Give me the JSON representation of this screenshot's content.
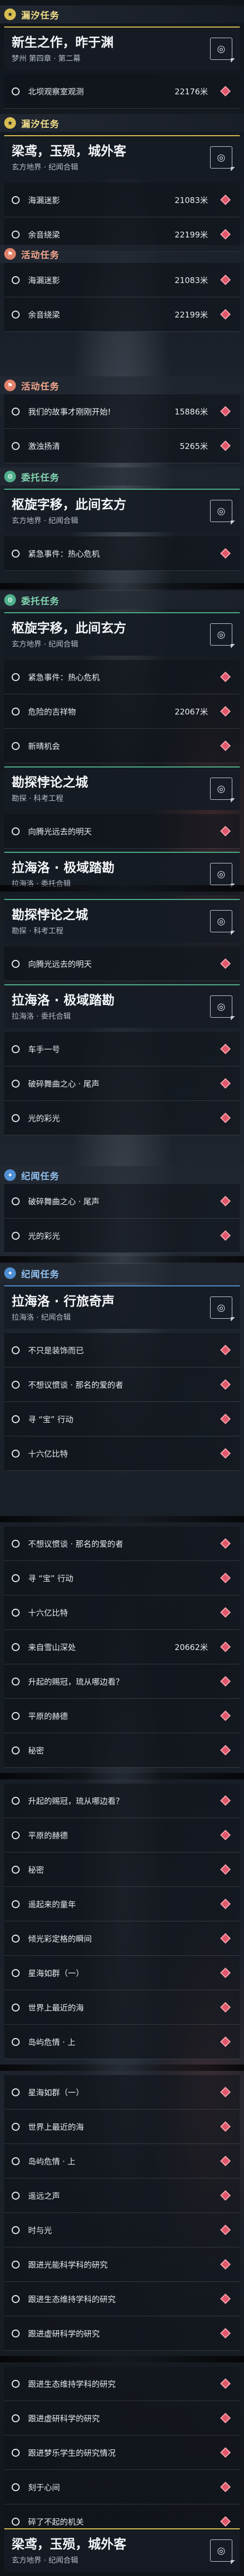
{
  "status_colors": {
    "story": "#d9bf52",
    "activity": "#e1826a",
    "daily": "#4fb08c",
    "legend": "#4f8fd3",
    "pin": "#e0566a"
  },
  "icons": {
    "story": "star-icon",
    "activity": "flag-icon",
    "daily": "gear-icon",
    "legend": "sparkle-icon",
    "checkbox": "objective-circle-icon",
    "pin": "map-pin-icon",
    "track": "track-quest-icon"
  },
  "categories": {
    "story": "漏汐任务",
    "story2": "漏汐任务",
    "activity": "活动任务",
    "daily": "委托任务",
    "legend": "纪闻任务"
  },
  "quests": {
    "q_story_intro": {
      "title": "新生之作，昨于渊",
      "sub": "梦州 第四章 · 第二幕"
    },
    "q_story_main": {
      "title": "梁鸢，玉殒，城外客",
      "sub": "玄方地界 · 纪闻合辑"
    },
    "q_daily_a": {
      "title": "枢旋字移，此间玄方",
      "sub": "玄方地界 · 纪闻合辑"
    },
    "q_daily_b": {
      "title": "勘探悖论之城",
      "sub": "勘探 · 科考工程"
    },
    "q_daily_c": {
      "title": "拉海洛 · 极域踏勘",
      "sub": "拉海洛 · 委托合辑"
    },
    "q_legend_a": {
      "title": "拉海洛 · 行旅奇声",
      "sub": "拉海洛 · 纪闻合辑"
    },
    "q_end": {
      "title": "梁鸢，玉殒，城外客",
      "sub": "玄方地界 · 纪闻合辑"
    }
  },
  "objectives": {
    "o1": {
      "text": "北坝观察室观测",
      "count": "22176米"
    },
    "o2": {
      "text": "海漏迷影",
      "count": "21083米"
    },
    "o3": {
      "text": "余音绕梁",
      "count": "22199米"
    },
    "o4": {
      "text": "我们的故事才刚刚开始!",
      "count": "15886米"
    },
    "o5": {
      "text": "激浊扬清",
      "count": "5265米"
    },
    "o6": {
      "text": "紧急事件：热心危机"
    },
    "o7": {
      "text": "危险的吉祥物",
      "count": "22067米"
    },
    "o8": {
      "text": "新晴机会"
    },
    "o9": {
      "text": "向腾光远去的明天"
    },
    "o10": {
      "text": "车手一号"
    },
    "o11": {
      "text": "破碎舞曲之心 · 尾声"
    },
    "o12": {
      "text": "光的彩光"
    },
    "o13": {
      "text": "不只是装饰而已"
    },
    "o14": {
      "text": "不想议惯谈 · 那名的爱的者"
    },
    "o15": {
      "text": "寻 “宝” 行动"
    },
    "o16": {
      "text": "十六亿比特"
    },
    "o17": {
      "text": "来自雪山深处",
      "count": "20662米"
    },
    "o18": {
      "text": "升起的赐冠，琉从哪边看？"
    },
    "o19": {
      "text": "平原的赫德"
    },
    "o20": {
      "text": "秘密"
    },
    "o21": {
      "text": "遥起来的童年"
    },
    "o22": {
      "text": "倾光彩定格的瞬间"
    },
    "o23": {
      "text": "星海如群（一）"
    },
    "o24": {
      "text": "世界上最近的海"
    },
    "o25": {
      "text": "岛屿危情 · 上"
    },
    "o26": {
      "text": "遥远之声"
    },
    "o27": {
      "text": "时与光"
    },
    "o28": {
      "text": "跟进光能科学科的研究"
    },
    "o29": {
      "text": "跟进生态维持学科的研究"
    },
    "o30": {
      "text": "跟进虚研科学的研究"
    },
    "o31": {
      "text": "跟进梦乐学生的研究情况"
    },
    "o32": {
      "text": "刻于心间"
    },
    "o33": {
      "text": "碎了不起的机关"
    }
  }
}
